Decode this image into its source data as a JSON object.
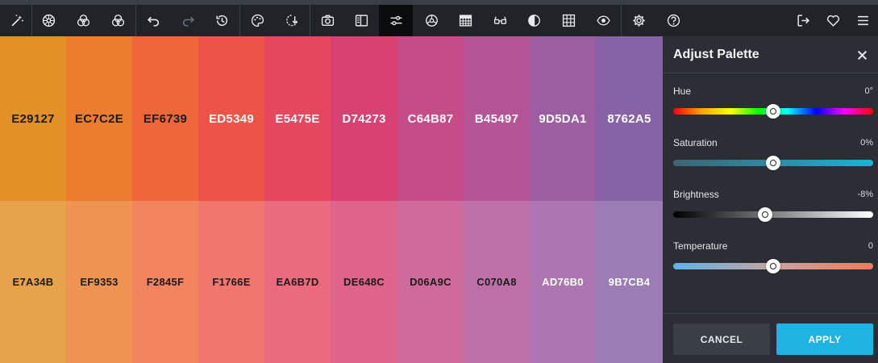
{
  "toolbar": {
    "left_tools": [
      {
        "name": "magic-wand-icon",
        "glyph": "✨"
      },
      {
        "name": "color-wheel-icon",
        "glyph": "⊛"
      },
      {
        "name": "color-blend-icon",
        "glyph": "⊕"
      },
      {
        "name": "shades-icon",
        "glyph": "⊗"
      },
      {
        "name": "undo-icon",
        "glyph": "↶"
      },
      {
        "name": "redo-icon",
        "glyph": "↷"
      },
      {
        "name": "history-icon",
        "glyph": "⟲"
      },
      {
        "name": "palette-icon",
        "glyph": "◐"
      },
      {
        "name": "color-picker-icon",
        "glyph": "⊙"
      },
      {
        "name": "camera-icon",
        "glyph": "▣"
      },
      {
        "name": "view-icon",
        "glyph": "▥"
      },
      {
        "name": "adjust-icon",
        "glyph": "⚌"
      },
      {
        "name": "contrast-icon",
        "glyph": "◎"
      },
      {
        "name": "table-icon",
        "glyph": "▦"
      },
      {
        "name": "glasses-icon",
        "glyph": "∞"
      },
      {
        "name": "half-circle-icon",
        "glyph": "◑"
      },
      {
        "name": "grid-icon",
        "glyph": "▦"
      },
      {
        "name": "eye-icon",
        "glyph": "◉"
      },
      {
        "name": "settings-icon",
        "glyph": "⚙"
      },
      {
        "name": "help-icon",
        "glyph": "?"
      }
    ],
    "right_tools": [
      {
        "name": "export-icon",
        "glyph": "⇥"
      },
      {
        "name": "heart-icon",
        "glyph": "♡"
      },
      {
        "name": "menu-icon",
        "glyph": "☰"
      }
    ]
  },
  "palette": {
    "top_row": [
      {
        "hex": "E29127",
        "color": "#e29127",
        "text_color": "#1b1b1b"
      },
      {
        "hex": "EC7C2E",
        "color": "#ec7c2e",
        "text_color": "#1b1b1b"
      },
      {
        "hex": "EF6739",
        "color": "#ef6739",
        "text_color": "#1b1b1b"
      },
      {
        "hex": "ED5349",
        "color": "#ed5349",
        "text_color": "#ffffff"
      },
      {
        "hex": "E5475E",
        "color": "#e5475e",
        "text_color": "#ffffff"
      },
      {
        "hex": "D74273",
        "color": "#d74273",
        "text_color": "#ffffff"
      },
      {
        "hex": "C64B87",
        "color": "#c64b87",
        "text_color": "#ffffff"
      },
      {
        "hex": "B45497",
        "color": "#b45497",
        "text_color": "#ffffff"
      },
      {
        "hex": "9D5DA1",
        "color": "#9d5da1",
        "text_color": "#ffffff"
      },
      {
        "hex": "8762A5",
        "color": "#8762a5",
        "text_color": "#ffffff"
      }
    ],
    "bottom_row": [
      {
        "hex": "E7A34B",
        "color": "#e7a34b",
        "text_color": "#1b1b1b"
      },
      {
        "hex": "EF9353",
        "color": "#ef9353",
        "text_color": "#1b1b1b"
      },
      {
        "hex": "F2845F",
        "color": "#f2845f",
        "text_color": "#1b1b1b"
      },
      {
        "hex": "F1766E",
        "color": "#f1766e",
        "text_color": "#1b1b1b"
      },
      {
        "hex": "EA6B7D",
        "color": "#ea6b7d",
        "text_color": "#1b1b1b"
      },
      {
        "hex": "DE648C",
        "color": "#de648c",
        "text_color": "#1b1b1b"
      },
      {
        "hex": "D06A9C",
        "color": "#d06a9c",
        "text_color": "#1b1b1b"
      },
      {
        "hex": "C070A8",
        "color": "#c070a8",
        "text_color": "#1b1b1b"
      },
      {
        "hex": "AD76B0",
        "color": "#ad76b0",
        "text_color": "#ffffff"
      },
      {
        "hex": "9B7CB4",
        "color": "#9b7cb4",
        "text_color": "#ffffff"
      }
    ]
  },
  "panel": {
    "title": "Adjust Palette",
    "close_icon": "close-icon",
    "controls": [
      {
        "id": "hue",
        "label": "Hue",
        "value": "0°",
        "level": 0.5
      },
      {
        "id": "saturation",
        "label": "Saturation",
        "value": "0%",
        "level": 0.5
      },
      {
        "id": "brightness",
        "label": "Brightness",
        "value": "-8%",
        "level": 0.46
      },
      {
        "id": "temperature",
        "label": "Temperature",
        "value": "0",
        "level": 0.5
      }
    ],
    "cancel_label": "CANCEL",
    "apply_label": "APPLY",
    "accent_color": "#1eb3e1"
  }
}
